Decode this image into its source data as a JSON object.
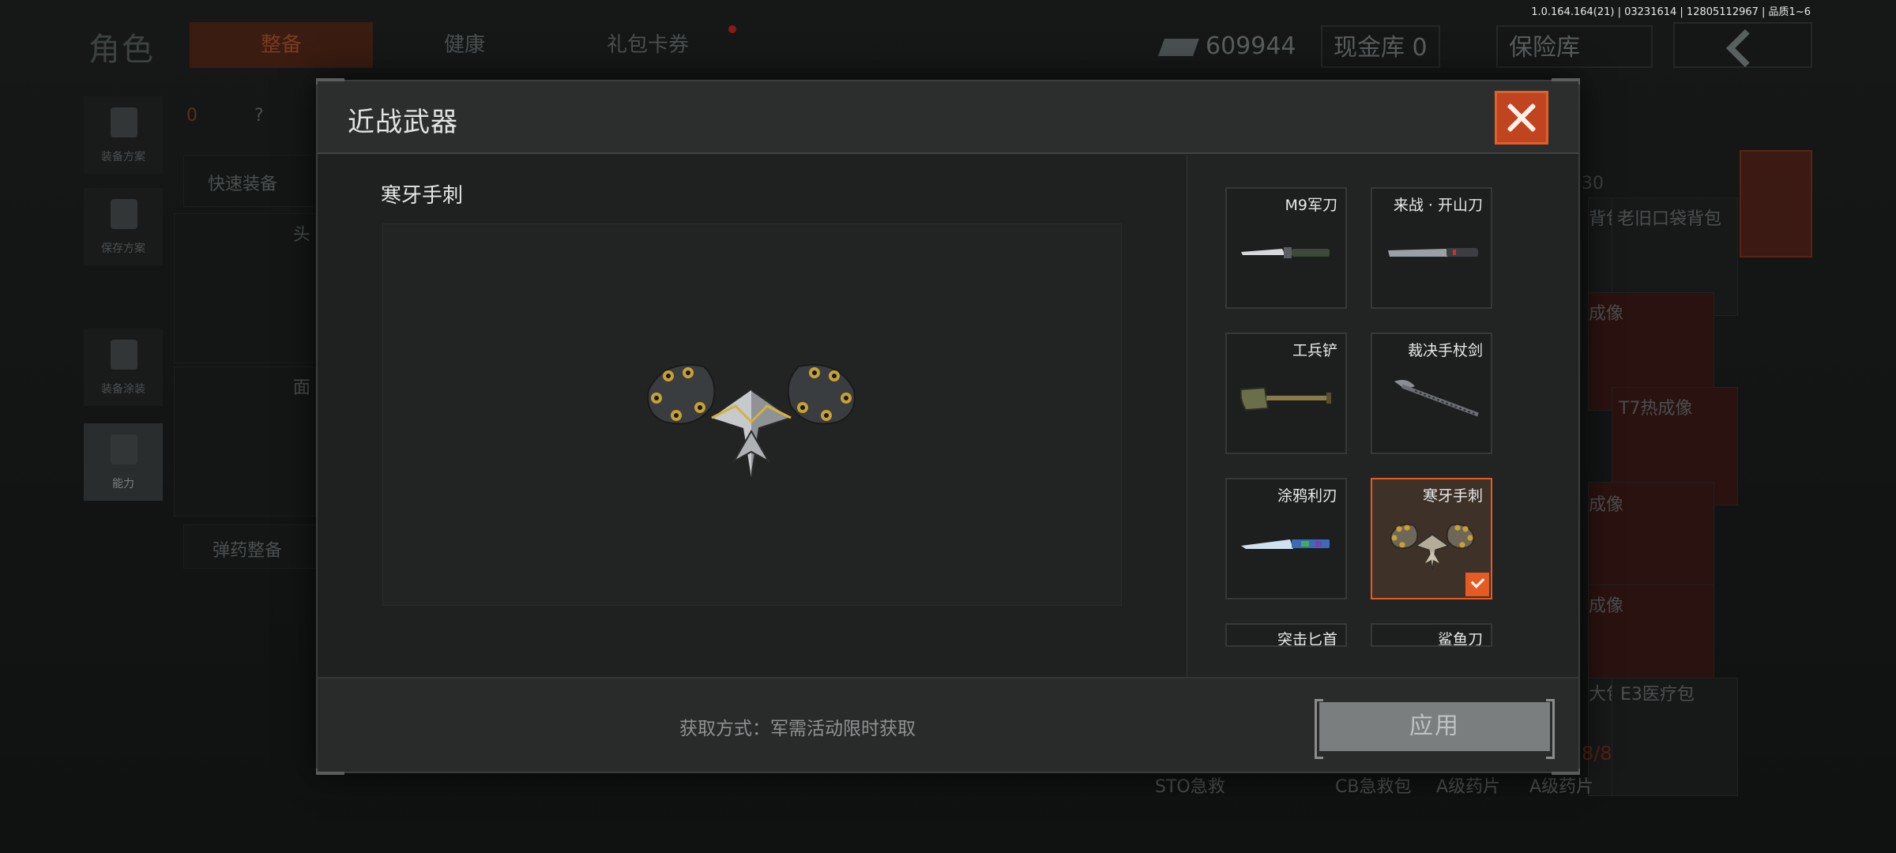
{
  "build_info": "1.0.164.164(21) | 03231614 | 12805112967 | 品质1~6",
  "background": {
    "logo": "角色",
    "tabs": [
      "整备",
      "健康",
      "礼包卡券"
    ],
    "cash_value": "609944",
    "cash_vault_label": "现金库 0",
    "safe_vault_label": "保险库",
    "side_buttons": [
      "装备方案",
      "保存方案",
      "装备涂装",
      "能力"
    ],
    "armor_count": "0",
    "unknown_badge": "?",
    "quick_equip": "快速装备",
    "ammo_equip": "弹药整备",
    "slot_labels": [
      "头",
      "面"
    ],
    "item_labels": [
      "背包",
      "老旧口袋背包",
      "成像",
      "T7热成像",
      "成像",
      "成像",
      "大包",
      "E3医疗包",
      "STO急救",
      "CB急救包",
      "A级药片",
      "A级药片"
    ],
    "capacity": "30",
    "count_red": "8/8"
  },
  "modal": {
    "title": "近战武器",
    "selected_name": "寒牙手刺",
    "acquire_text": "获取方式：军需活动限时获取",
    "apply_label": "应用",
    "weapons": [
      {
        "name": "M9军刀",
        "icon": "bayonet-icon"
      },
      {
        "name": "来战 · 开山刀",
        "icon": "machete-icon"
      },
      {
        "name": "工兵铲",
        "icon": "shovel-icon"
      },
      {
        "name": "裁决手杖剑",
        "icon": "cane-sword-icon"
      },
      {
        "name": "涂鸦利刃",
        "icon": "graffiti-blade-icon"
      },
      {
        "name": "寒牙手刺",
        "icon": "frost-fang-icon",
        "selected": true
      },
      {
        "name": "突击匕首",
        "icon": "assault-dagger-icon"
      },
      {
        "name": "鲨鱼刀",
        "icon": "shark-knife-icon"
      }
    ]
  },
  "colors": {
    "accent": "#e65a24",
    "close_bg": "#c04420",
    "apply_bg": "#7b7e7e",
    "selected_card_bg": "#3e3228"
  }
}
